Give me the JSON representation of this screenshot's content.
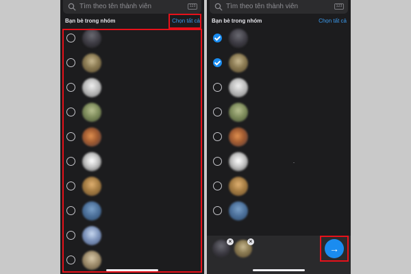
{
  "left_panel": {
    "search": {
      "placeholder": "Tìm theo tên thành viên",
      "badge": "123"
    },
    "section_title": "Bạn bè trong nhóm",
    "select_all": "Chọn tất cả",
    "members": [
      {
        "checked": false
      },
      {
        "checked": false
      },
      {
        "checked": false
      },
      {
        "checked": false
      },
      {
        "checked": false
      },
      {
        "checked": false
      },
      {
        "checked": false
      },
      {
        "checked": false
      },
      {
        "checked": false
      },
      {
        "checked": false
      }
    ]
  },
  "right_panel": {
    "search": {
      "placeholder": "Tìm theo tên thành viên",
      "badge": "123"
    },
    "section_title": "Bạn bè trong nhóm",
    "select_all": "Chọn tất cả",
    "members": [
      {
        "checked": true
      },
      {
        "checked": true
      },
      {
        "checked": false
      },
      {
        "checked": false
      },
      {
        "checked": false
      },
      {
        "checked": false
      },
      {
        "checked": false
      },
      {
        "checked": false
      },
      {
        "checked": false
      }
    ],
    "selected_tray": {
      "remove_symbol": "×",
      "next_symbol": "→"
    }
  },
  "colors": {
    "accent": "#1a8cf0",
    "link": "#3b9cf0",
    "highlight": "#e8111a",
    "background": "#1c1c1e"
  }
}
